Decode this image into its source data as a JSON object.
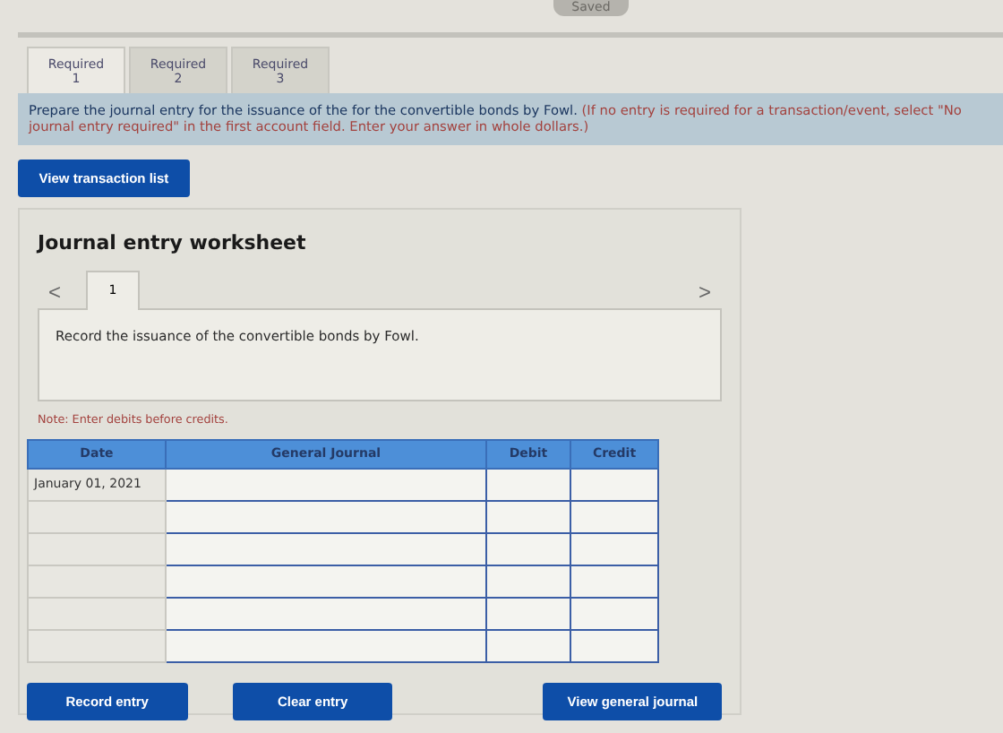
{
  "status": "Saved",
  "tabs": [
    {
      "label": "Required 1",
      "selected": true
    },
    {
      "label": "Required 2",
      "selected": false
    },
    {
      "label": "Required 3",
      "selected": false
    }
  ],
  "instruction": {
    "text": "Prepare the journal entry for the issuance of the for the convertible bonds by Fowl.",
    "hint": "(If no entry is required for a transaction/event, select \"No journal entry required\" in the first account field. Enter your answer in whole dollars.)"
  },
  "view_transaction_button": "View transaction list",
  "worksheet": {
    "title": "Journal entry worksheet",
    "prev": "<",
    "next": ">",
    "entry_tabs": [
      {
        "label": "1",
        "selected": true
      }
    ],
    "description": "Record the issuance of the convertible bonds by Fowl.",
    "note": "Note: Enter debits before credits.",
    "table": {
      "columns": [
        "Date",
        "General Journal",
        "Debit",
        "Credit"
      ],
      "rows": [
        {
          "date": "January 01, 2021"
        },
        {},
        {},
        {},
        {},
        {}
      ]
    },
    "buttons": [
      "Record entry",
      "Clear entry",
      "View general journal"
    ]
  }
}
